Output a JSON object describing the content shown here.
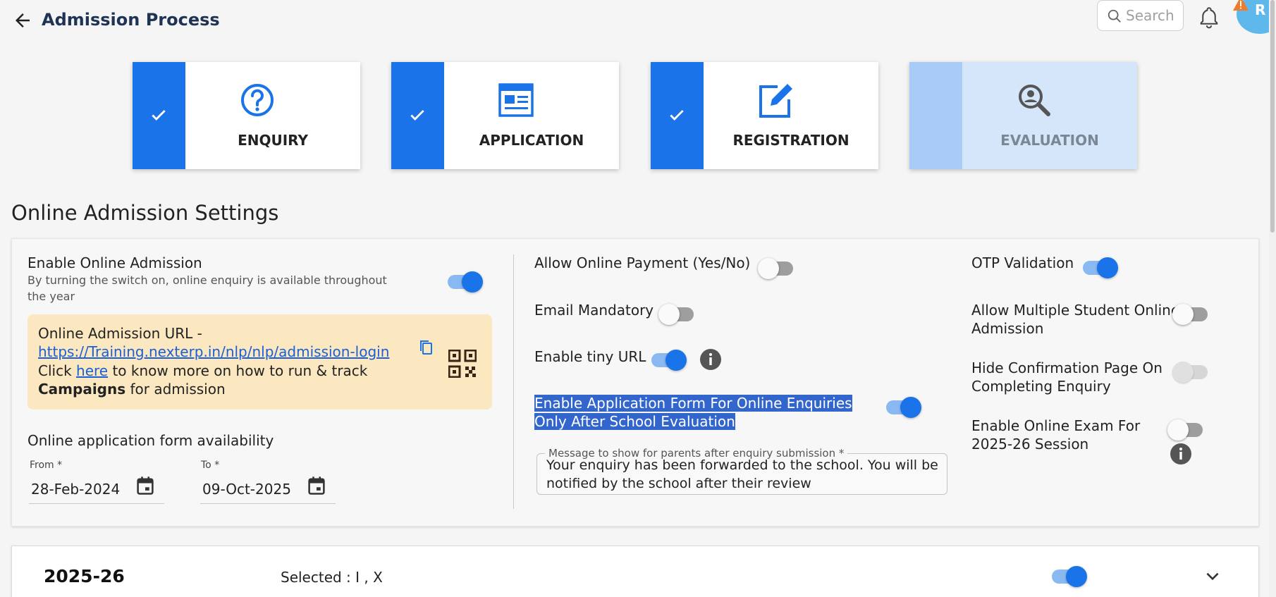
{
  "header": {
    "title": "Admission Process",
    "search_placeholder": "Search",
    "avatar_initial": "R"
  },
  "stepper": [
    {
      "label": "ENQUIRY",
      "icon": "question-circle-icon",
      "status": "completed"
    },
    {
      "label": "APPLICATION",
      "icon": "form-document-icon",
      "status": "completed"
    },
    {
      "label": "REGISTRATION",
      "icon": "edit-square-icon",
      "status": "completed"
    },
    {
      "label": "EVALUATION",
      "icon": "magnify-person-icon",
      "status": "pending"
    }
  ],
  "settings": {
    "title": "Online Admission Settings",
    "enable_online_admission": {
      "label": "Enable Online Admission",
      "description": "By turning the switch on, online enquiry is available throughout the year",
      "on": true
    },
    "url_card": {
      "line1": "Online Admission URL -",
      "url": "https://Training.nexterp.in/nlp/nlp/admission-login",
      "click": "Click ",
      "here": "here",
      "middle": " to know more on how to run & track ",
      "campaigns": "Campaigns",
      "end": " for admission"
    },
    "availability": {
      "label": "Online application form availability",
      "from_label": "From *",
      "from_value": "28-Feb-2024",
      "to_label": "To *",
      "to_value": "09-Oct-2025"
    },
    "allow_online_payment": {
      "label": "Allow Online Payment (Yes/No)",
      "on": false
    },
    "email_mandatory": {
      "label": "Email Mandatory",
      "on": false
    },
    "enable_tiny_url": {
      "label": "Enable tiny URL",
      "on": true
    },
    "enable_app_form_after_eval": {
      "label": "Enable Application Form For Online Enquiries Only After School Evaluation",
      "on": true
    },
    "message": {
      "label": "Message to show for parents after enquiry submission *",
      "value": "Your enquiry has been forwarded to the school. You will be notified by the school after their review"
    },
    "otp_validation": {
      "label": "OTP Validation",
      "on": true
    },
    "allow_multiple_student": {
      "label": "Allow Multiple Student Online Admission",
      "on": false
    },
    "hide_confirmation": {
      "label": "Hide Confirmation Page On Completing Enquiry",
      "on": false,
      "disabled": true
    },
    "enable_online_exam": {
      "label": "Enable Online Exam For 2025-26 Session",
      "on": false
    }
  },
  "session": {
    "year": "2025-26",
    "selected": "Selected : I , X",
    "on": true
  },
  "colors": {
    "primary": "#1a73e8",
    "title": "#1f3455",
    "highlight": "#3366cc",
    "url_card_bg": "#fbe7c0"
  }
}
